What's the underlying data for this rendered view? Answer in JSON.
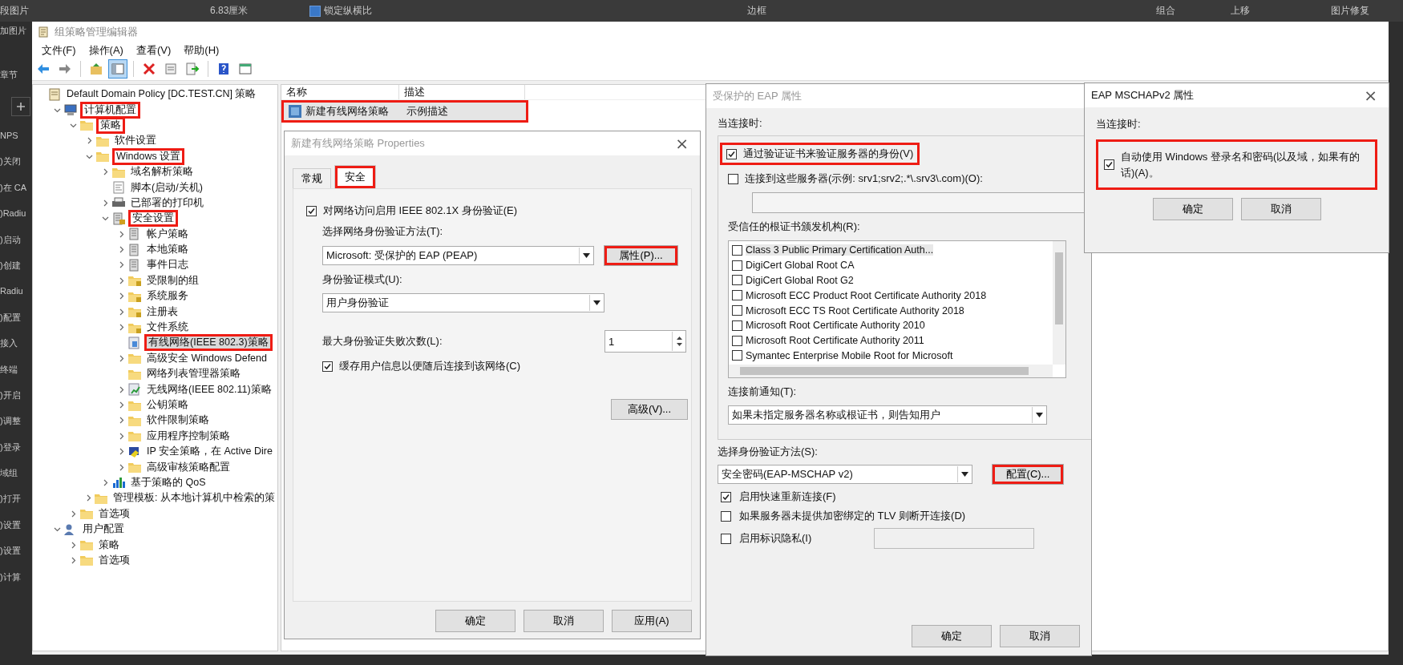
{
  "background": {
    "toolbar_texts": [
      "段图片",
      "6.83厘米",
      "锁定纵横比",
      "边框",
      "组合",
      "上移",
      "图片修复"
    ],
    "aspect_locked": true,
    "side_texts": [
      "加图片",
      "章节"
    ],
    "outline_items": [
      "NPS",
      ")关闭",
      ")在 CA",
      ")Radiu",
      ")启动",
      ")创建",
      "Radiu",
      ")配置",
      "接入",
      "终端",
      ")开启",
      ")调整",
      ")登录",
      "域组",
      ")打开",
      ")设置",
      ")设置",
      ")计算"
    ]
  },
  "window": {
    "title": "组策略管理编辑器",
    "menu": [
      "文件(F)",
      "操作(A)",
      "查看(V)",
      "帮助(H)"
    ],
    "toolbar": [
      [
        {
          "kind": "back",
          "selected": false
        },
        {
          "kind": "forward",
          "selected": false
        }
      ],
      [
        {
          "kind": "up",
          "selected": false
        },
        {
          "kind": "pane",
          "selected": true
        }
      ],
      [
        {
          "kind": "delete",
          "selected": false
        },
        {
          "kind": "props",
          "selected": false
        },
        {
          "kind": "export",
          "selected": false
        }
      ],
      [
        {
          "kind": "help",
          "selected": false
        },
        {
          "kind": "view",
          "selected": false
        }
      ]
    ]
  },
  "tree": [
    {
      "label": "Default Domain Policy [DC.TEST.CN] 策略",
      "kind": "doc",
      "selected": false,
      "highlighted": false,
      "children": [
        {
          "label": "计算机配置",
          "kind": "computer",
          "expanded": true,
          "selected": false,
          "highlighted": true,
          "children": [
            {
              "label": "策略",
              "kind": "folder",
              "expanded": true,
              "selected": false,
              "highlighted": true,
              "children": [
                {
                  "label": "软件设置",
                  "kind": "folder",
                  "expanded": false,
                  "selected": false,
                  "highlighted": false
                },
                {
                  "label": "Windows 设置",
                  "kind": "folder",
                  "expanded": true,
                  "selected": false,
                  "highlighted": true,
                  "children": [
                    {
                      "label": "域名解析策略",
                      "kind": "folder",
                      "expanded": false,
                      "selected": false,
                      "highlighted": false
                    },
                    {
                      "label": "脚本(启动/关机)",
                      "kind": "script",
                      "selected": false,
                      "highlighted": false
                    },
                    {
                      "label": "已部署的打印机",
                      "kind": "printer",
                      "expanded": false,
                      "selected": false,
                      "highlighted": false
                    },
                    {
                      "label": "安全设置",
                      "kind": "security",
                      "expanded": true,
                      "selected": false,
                      "highlighted": true,
                      "children": [
                        {
                          "label": "帐户策略",
                          "kind": "policy",
                          "expanded": false,
                          "selected": false,
                          "highlighted": false
                        },
                        {
                          "label": "本地策略",
                          "kind": "policy",
                          "expanded": false,
                          "selected": false,
                          "highlighted": false
                        },
                        {
                          "label": "事件日志",
                          "kind": "policy",
                          "expanded": false,
                          "selected": false,
                          "highlighted": false
                        },
                        {
                          "label": "受限制的组",
                          "kind": "lockfolder",
                          "expanded": false,
                          "selected": false,
                          "highlighted": false
                        },
                        {
                          "label": "系统服务",
                          "kind": "lockfolder",
                          "expanded": false,
                          "selected": false,
                          "highlighted": false
                        },
                        {
                          "label": "注册表",
                          "kind": "lockfolder",
                          "expanded": false,
                          "selected": false,
                          "highlighted": false
                        },
                        {
                          "label": "文件系统",
                          "kind": "lockfolder",
                          "expanded": false,
                          "selected": false,
                          "highlighted": false
                        },
                        {
                          "label": "有线网络(IEEE 802.3)策略",
                          "kind": "wired",
                          "selected": true,
                          "highlighted": true
                        },
                        {
                          "label": "高级安全 Windows Defend",
                          "kind": "folder",
                          "expanded": false,
                          "selected": false,
                          "highlighted": false
                        },
                        {
                          "label": "网络列表管理器策略",
                          "kind": "folder",
                          "selected": false,
                          "highlighted": false
                        },
                        {
                          "label": "无线网络(IEEE 802.11)策略",
                          "kind": "wireless",
                          "expanded": false,
                          "selected": false,
                          "highlighted": false
                        },
                        {
                          "label": "公钥策略",
                          "kind": "folder",
                          "expanded": false,
                          "selected": false,
                          "highlighted": false
                        },
                        {
                          "label": "软件限制策略",
                          "kind": "folder",
                          "expanded": false,
                          "selected": false,
                          "highlighted": false
                        },
                        {
                          "label": "应用程序控制策略",
                          "kind": "folder",
                          "expanded": false,
                          "selected": false,
                          "highlighted": false
                        },
                        {
                          "label": "IP 安全策略，在 Active Dire",
                          "kind": "ip",
                          "expanded": false,
                          "selected": false,
                          "highlighted": false
                        },
                        {
                          "label": "高级审核策略配置",
                          "kind": "folder",
                          "expanded": false,
                          "selected": false,
                          "highlighted": false
                        }
                      ]
                    },
                    {
                      "label": "基于策略的 QoS",
                      "kind": "qos",
                      "expanded": false,
                      "selected": false,
                      "highlighted": false
                    }
                  ]
                },
                {
                  "label": "管理模板: 从本地计算机中检索的策",
                  "kind": "folder",
                  "expanded": false,
                  "selected": false,
                  "highlighted": false
                }
              ]
            },
            {
              "label": "首选项",
              "kind": "folder",
              "expanded": false,
              "selected": false,
              "highlighted": false
            }
          ]
        },
        {
          "label": "用户配置",
          "kind": "user",
          "expanded": true,
          "selected": false,
          "highlighted": false,
          "children": [
            {
              "label": "策略",
              "kind": "folder",
              "expanded": false,
              "selected": false,
              "highlighted": false
            },
            {
              "label": "首选项",
              "kind": "folder",
              "expanded": false,
              "selected": false,
              "highlighted": false
            }
          ]
        }
      ]
    }
  ],
  "list": {
    "columns": [
      "名称",
      "描述"
    ],
    "rows": [
      {
        "name": "新建有线网络策略",
        "description": "示例描述",
        "selected": true,
        "highlighted": true
      }
    ]
  },
  "properties_dialog": {
    "title": "新建有线网络策略 Properties",
    "close": "×",
    "tabs": [
      {
        "label": "常规",
        "selected": false,
        "highlighted": false
      },
      {
        "label": "安全",
        "selected": true,
        "highlighted": true
      }
    ],
    "enable_8021x": {
      "label": "对网络访问启用 IEEE 802.1X 身份验证(E)",
      "checked": true
    },
    "method_label": "选择网络身份验证方法(T):",
    "method": "Microsoft: 受保护的 EAP (PEAP)",
    "properties_button": {
      "label": "属性(P)...",
      "highlighted": true
    },
    "mode_label": "身份验证模式(U):",
    "mode": "用户身份验证",
    "max_failures_label": "最大身份验证失败次数(L):",
    "max_failures": "1",
    "cache": {
      "label": "缓存用户信息以便随后连接到该网络(C)",
      "checked": true
    },
    "advanced_button": "高级(V)...",
    "buttons": [
      "确定",
      "取消",
      "应用(A)"
    ]
  },
  "eap_dialog": {
    "title": "受保护的 EAP 属性",
    "when_connecting": "当连接时:",
    "verify": {
      "label": "通过验证证书来验证服务器的身份(V)",
      "checked": true,
      "highlighted": true
    },
    "connect_servers": {
      "label": "连接到这些服务器(示例: srv1;srv2;.*\\.srv3\\.com)(O):",
      "checked": false
    },
    "roots_label": "受信任的根证书颁发机构(R):",
    "roots": [
      {
        "name": "Class 3 Public Primary Certification Auth...",
        "checked": false,
        "selected": true
      },
      {
        "name": "DigiCert Global Root CA",
        "checked": false,
        "selected": false
      },
      {
        "name": "DigiCert Global Root G2",
        "checked": false,
        "selected": false
      },
      {
        "name": "Microsoft ECC Product Root Certificate Authority 2018",
        "checked": false,
        "selected": false
      },
      {
        "name": "Microsoft ECC TS Root Certificate Authority 2018",
        "checked": false,
        "selected": false
      },
      {
        "name": "Microsoft Root Certificate Authority 2010",
        "checked": false,
        "selected": false
      },
      {
        "name": "Microsoft Root Certificate Authority 2011",
        "checked": false,
        "selected": false
      },
      {
        "name": "Symantec Enterprise Mobile Root for Microsoft",
        "checked": false,
        "selected": false
      }
    ],
    "notify_label": "连接前通知(T):",
    "notify": "如果未指定服务器名称或根证书，则告知用户",
    "method_label": "选择身份验证方法(S):",
    "method": "安全密码(EAP-MSCHAP v2)",
    "configure_button": {
      "label": "配置(C)...",
      "highlighted": true
    },
    "options": [
      {
        "label": "启用快速重新连接(F)",
        "checked": true
      },
      {
        "label": "如果服务器未提供加密绑定的 TLV 则断开连接(D)",
        "checked": false
      },
      {
        "label": "启用标识隐私(I)",
        "checked": false
      }
    ],
    "buttons": [
      "确定",
      "取消"
    ]
  },
  "mschap_dialog": {
    "title": "EAP MSCHAPv2 属性",
    "close": "×",
    "when_connecting": "当连接时:",
    "auto_logon": {
      "label": "自动使用 Windows 登录名和密码(以及域，如果有的话)(A)。",
      "checked": true,
      "highlighted": true
    },
    "buttons": [
      "确定",
      "取消"
    ]
  }
}
